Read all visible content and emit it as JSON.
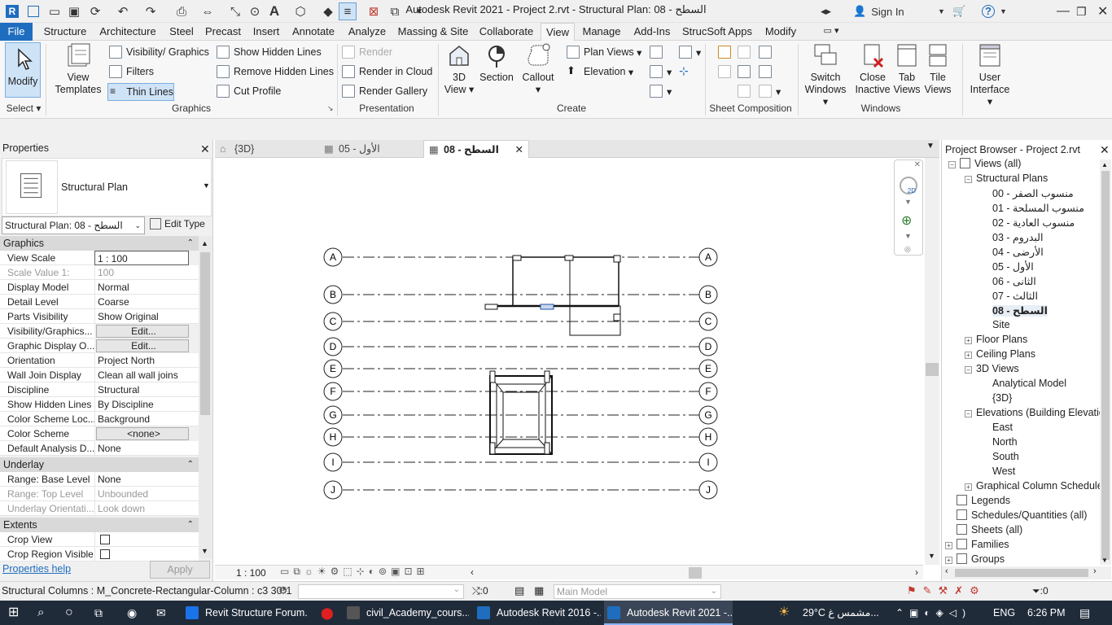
{
  "window": {
    "title": "Autodesk Revit 2021 - Project 2.rvt - Structural Plan: 08 - السطح",
    "sign_in": "Sign In"
  },
  "menu": [
    "File",
    "Structure",
    "Architecture",
    "Steel",
    "Precast",
    "Insert",
    "Annotate",
    "Analyze",
    "Massing & Site",
    "Collaborate",
    "View",
    "Manage",
    "Add-Ins",
    "StrucSoft Apps",
    "Modify"
  ],
  "ribbon": {
    "modify": "Modify",
    "select": "Select",
    "view_templates_1": "View",
    "view_templates_2": "Templates",
    "visibility": "Visibility/ Graphics",
    "filters": "Filters",
    "thin_lines": "Thin Lines",
    "show_hidden": "Show  Hidden Lines",
    "remove_hidden": "Remove  Hidden Lines",
    "cut_profile": "Cut  Profile",
    "graphics": "Graphics",
    "render": "Render",
    "render_cloud": "Render  in Cloud",
    "render_gallery": "Render  Gallery",
    "presentation": "Presentation",
    "view3d_1": "3D",
    "view3d_2": "View",
    "section": "Section",
    "callout": "Callout",
    "plan_views": "Plan  Views",
    "elevation": "Elevation",
    "create": "Create",
    "sheet_comp": "Sheet Composition",
    "switch_1": "Switch",
    "switch_2": "Windows",
    "close_1": "Close",
    "close_2": "Inactive",
    "tab_1": "Tab",
    "tab_2": "Views",
    "tile_1": "Tile",
    "tile_2": "Views",
    "windows": "Windows",
    "ui_1": "User",
    "ui_2": "Interface"
  },
  "properties": {
    "title": "Properties",
    "type": "Structural Plan",
    "selector": "Structural Plan: 08 - السطح",
    "edit_type": "Edit Type",
    "graphics_group": "Graphics",
    "rows": [
      {
        "k": "View Scale",
        "v": "1 : 100"
      },
      {
        "k": "Scale Value    1:",
        "v": "100"
      },
      {
        "k": "Display Model",
        "v": "Normal"
      },
      {
        "k": "Detail Level",
        "v": "Coarse"
      },
      {
        "k": "Parts Visibility",
        "v": "Show Original"
      },
      {
        "k": "Visibility/Graphics...",
        "v": "Edit..."
      },
      {
        "k": "Graphic Display O...",
        "v": "Edit..."
      },
      {
        "k": "Orientation",
        "v": "Project North"
      },
      {
        "k": "Wall Join Display",
        "v": "Clean all wall joins"
      },
      {
        "k": "Discipline",
        "v": "Structural"
      },
      {
        "k": "Show Hidden Lines",
        "v": "By Discipline"
      },
      {
        "k": "Color Scheme Loc...",
        "v": "Background"
      },
      {
        "k": "Color Scheme",
        "v": "<none>"
      },
      {
        "k": "Default Analysis D...",
        "v": "None"
      }
    ],
    "underlay_group": "Underlay",
    "underlay_rows": [
      {
        "k": "Range: Base Level",
        "v": "None"
      },
      {
        "k": "Range: Top Level",
        "v": "Unbounded"
      },
      {
        "k": "Underlay Orientati...",
        "v": "Look down"
      }
    ],
    "extents_group": "Extents",
    "extents_rows": [
      {
        "k": "Crop View"
      },
      {
        "k": "Crop Region Visible"
      }
    ],
    "help": "Properties help",
    "apply": "Apply"
  },
  "view_tabs": [
    {
      "label": "{3D}"
    },
    {
      "label": "الأول - 05"
    },
    {
      "label": "السطح - 08"
    }
  ],
  "grids": [
    "A",
    "B",
    "C",
    "D",
    "E",
    "F",
    "G",
    "H",
    "I",
    "J"
  ],
  "view_bar": {
    "scale": "1 : 100"
  },
  "browser": {
    "title": "Project Browser - Project 2.rvt",
    "items": [
      {
        "label": "Views (all)"
      },
      {
        "label": "Structural Plans"
      },
      {
        "label": "00 - منسوب الصفر"
      },
      {
        "label": "01 - منسوب المسلحة"
      },
      {
        "label": "02 - منسوب العادية"
      },
      {
        "label": "03 - البدروم"
      },
      {
        "label": "04 - الأرضى"
      },
      {
        "label": "05 - الأول"
      },
      {
        "label": "06 - الثانى"
      },
      {
        "label": "07 - الثالث"
      },
      {
        "label": "08 - السطح"
      },
      {
        "label": "Site"
      },
      {
        "label": "Floor Plans"
      },
      {
        "label": "Ceiling Plans"
      },
      {
        "label": "3D Views"
      },
      {
        "label": "Analytical Model"
      },
      {
        "label": "{3D}"
      },
      {
        "label": "Elevations (Building Elevatic"
      },
      {
        "label": "East"
      },
      {
        "label": "North"
      },
      {
        "label": "South"
      },
      {
        "label": "West"
      },
      {
        "label": "Graphical Column Schedule"
      },
      {
        "label": "Legends"
      },
      {
        "label": "Schedules/Quantities (all)"
      },
      {
        "label": "Sheets (all)"
      },
      {
        "label": "Families"
      },
      {
        "label": "Groups"
      }
    ]
  },
  "status": {
    "text": "Structural Columns : M_Concrete-Rectangular-Column : c3 30*1",
    "zero1": ":0",
    "model": "Main Model",
    "zero2": ":0"
  },
  "taskbar": {
    "items": [
      {
        "label": "Revit Structure Forum..."
      },
      {
        "label": "civil_Academy_cours..."
      },
      {
        "label": "Autodesk Revit 2016 -..."
      },
      {
        "label": "Autodesk Revit 2021 -..."
      }
    ],
    "weather": "29°C  مشمس غ...",
    "lang": "ENG",
    "time": "6:26 PM"
  },
  "colors": {
    "accent": "#1f6dbf",
    "taskbar": "#202b3a"
  }
}
